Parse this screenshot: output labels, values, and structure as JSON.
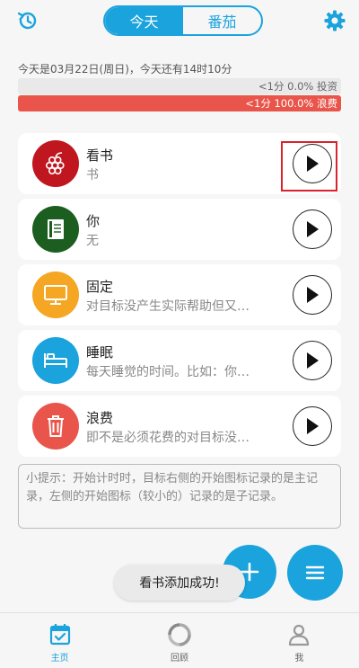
{
  "header": {
    "tabs": [
      {
        "label": "今天",
        "active": true
      },
      {
        "label": "番茄",
        "active": false
      }
    ],
    "history_icon": "history-icon",
    "settings_icon": "gear-icon",
    "accent_color": "#1aa3dd"
  },
  "summary": {
    "date_text": "今天是03月22日(周日)，今天还有14时10分",
    "invest_bar": {
      "text": "<1分 0.0% 投资",
      "fraction": 0.0
    },
    "waste_bar": {
      "text": "<1分 100.0% 浪费",
      "fraction": 1.0,
      "color": "#e9554b"
    }
  },
  "activities": [
    {
      "title": "看书",
      "subtitle": "书",
      "icon": "grapes-icon",
      "color": "#c0161f",
      "highlighted": true
    },
    {
      "title": "你",
      "subtitle": "无",
      "icon": "book-icon",
      "color": "#1b5e20"
    },
    {
      "title": "固定",
      "subtitle": "对目标没产生实际帮助但又…",
      "icon": "monitor-icon",
      "color": "#f5a623"
    },
    {
      "title": "睡眠",
      "subtitle": "每天睡觉的时间。比如：你…",
      "icon": "bed-icon",
      "color": "#1aa3dd"
    },
    {
      "title": "浪费",
      "subtitle": "即不是必须花费的对目标没…",
      "icon": "trash-icon",
      "color": "#e9554b"
    }
  ],
  "tip": {
    "text": "小提示：开始计时时，目标右侧的开始图标记录的是主记录，左侧的开始图标（较小的）记录的是子记录。"
  },
  "toast": {
    "text": "看书添加成功!"
  },
  "bottom_nav": [
    {
      "label": "主页",
      "icon": "calendar-check-icon",
      "active": true
    },
    {
      "label": "回顾",
      "icon": "review-ring-icon",
      "active": false
    },
    {
      "label": "我",
      "icon": "person-icon",
      "active": false
    }
  ]
}
